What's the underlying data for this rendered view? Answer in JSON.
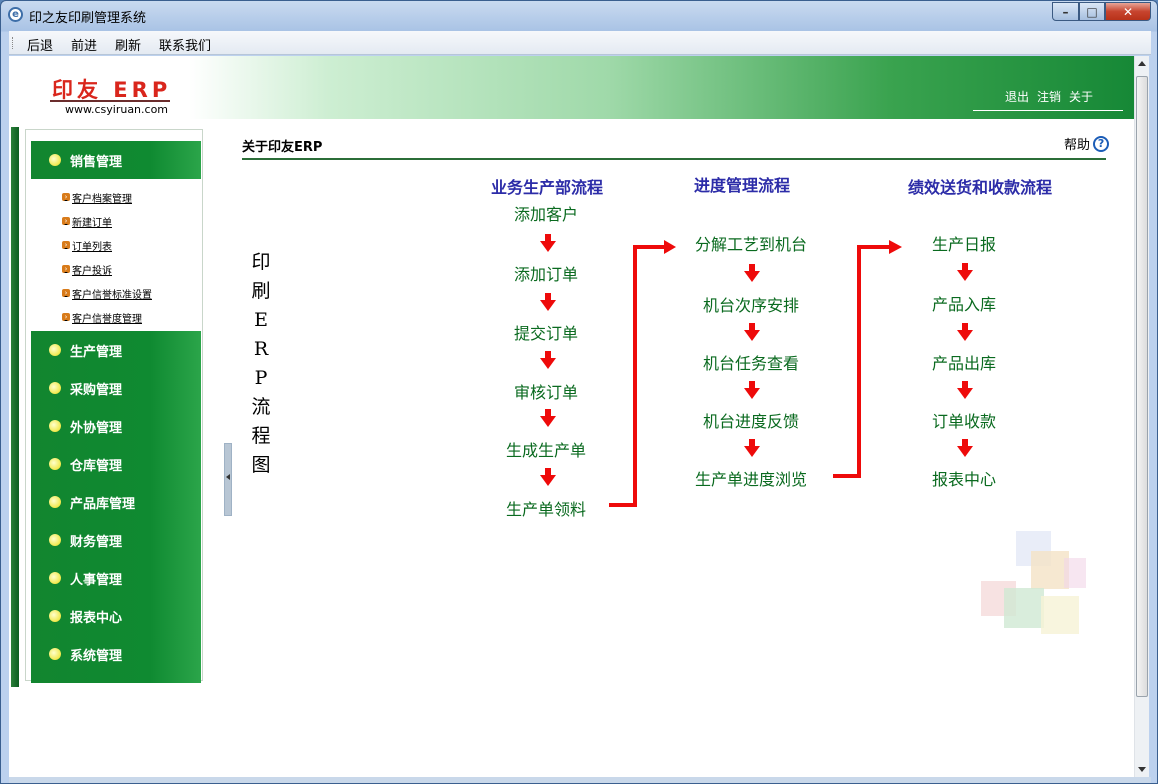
{
  "window": {
    "title": "印之友印刷管理系统",
    "min_label": "–",
    "max_label": "□",
    "close_label": "✕"
  },
  "menubar": {
    "items": [
      "后退",
      "前进",
      "刷新",
      "联系我们"
    ]
  },
  "header": {
    "logo": "印友 ERP",
    "url": "www.csyiruan.com",
    "links": [
      "退出",
      "注销",
      "关于"
    ]
  },
  "sidebar": {
    "active": {
      "label": "销售管理",
      "sub_items": [
        "客户档案管理",
        "新建订单",
        "订单列表",
        "客户投诉",
        "客户信誉标准设置",
        "客户信誉度管理"
      ]
    },
    "groups": [
      "生产管理",
      "采购管理",
      "外协管理",
      "仓库管理",
      "产品库管理",
      "财务管理",
      "人事管理",
      "报表中心",
      "系统管理"
    ]
  },
  "panel": {
    "title": "关于印友ERP",
    "help": "帮助",
    "help_icon": "?",
    "vertical_title": [
      "印",
      "刷",
      "E",
      "R",
      "P",
      "流",
      "程",
      "图"
    ]
  },
  "flow": {
    "col1": {
      "title": "业务生产部流程",
      "steps": [
        "添加客户",
        "添加订单",
        "提交订单",
        "审核订单",
        "生成生产单",
        "生产单领料"
      ]
    },
    "col2": {
      "title": "进度管理流程",
      "steps": [
        "分解工艺到机台",
        "机台次序安排",
        "机台任务查看",
        "机台进度反馈",
        "生产单进度浏览"
      ]
    },
    "col3": {
      "title": "绩效送货和收款流程",
      "steps": [
        "生产日报",
        "产品入库",
        "产品出库",
        "订单收款",
        "报表中心"
      ]
    }
  },
  "colors": {
    "accent_green": "#0f8a31",
    "arrow_red": "#ee0a0a",
    "flow_text": "#0a6a1f",
    "col_title": "#2c2ca8"
  }
}
